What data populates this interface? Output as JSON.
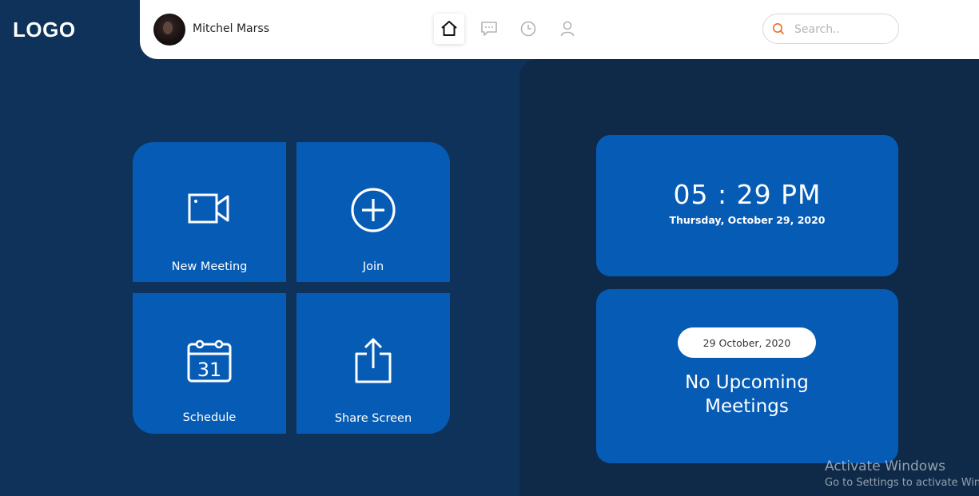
{
  "brand": {
    "logo_text": "LOGO"
  },
  "user": {
    "name": "Mitchel Marss"
  },
  "nav": {
    "home": "home-icon",
    "chat": "chat-icon",
    "history": "clock-icon",
    "profile": "user-icon"
  },
  "search": {
    "placeholder": "Search..",
    "value": ""
  },
  "actions": {
    "new_meeting": "New Meeting",
    "join": "Join",
    "schedule": "Schedule",
    "share_screen": "Share Screen",
    "calendar_day": "31"
  },
  "clock": {
    "time": "05 : 29 PM",
    "date": "Thursday, October 29, 2020"
  },
  "meetings": {
    "date": "29 October, 2020",
    "empty_line1": "No Upcoming",
    "empty_line2": "Meetings"
  },
  "os_watermark": {
    "title": "Activate Windows",
    "subtitle": "Go to Settings to activate Windows."
  },
  "colors": {
    "background": "#0e3259",
    "panel": "#0f2a48",
    "tile": "#065bb5",
    "accent_search": "#f26b21"
  }
}
